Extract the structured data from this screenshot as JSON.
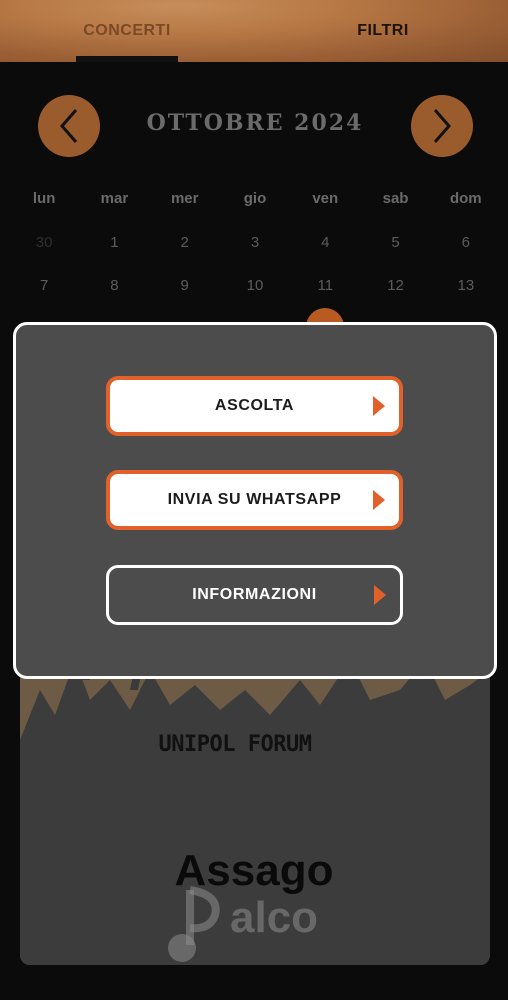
{
  "tabs": {
    "concerti": "CONCERTI",
    "filtri": "FILTRI"
  },
  "calendar": {
    "month_title": "OTTOBRE 2024",
    "weekdays": [
      "lun",
      "mar",
      "mer",
      "gio",
      "ven",
      "sab",
      "dom"
    ],
    "week1": [
      "30",
      "1",
      "2",
      "3",
      "4",
      "5",
      "6"
    ],
    "week2": [
      "7",
      "8",
      "9",
      "10",
      "11",
      "12",
      "13"
    ]
  },
  "modal": {
    "ascolta": "ASCOLTA",
    "whatsapp": "INVIA SU WHATSAPP",
    "informazioni": "INFORMAZIONI"
  },
  "event": {
    "venue": "UNIPOL FORUM",
    "city": "Assago",
    "watermark": "alco"
  },
  "colors": {
    "accent": "#e2612a",
    "nav_button": "#9a5c2c",
    "modal_bg": "#4c4c4c",
    "tab_bar": "#c7834b"
  },
  "icons": {
    "prev": "chevron-left-icon",
    "next": "chevron-right-icon",
    "button_arrow": "triangle-right-icon"
  }
}
